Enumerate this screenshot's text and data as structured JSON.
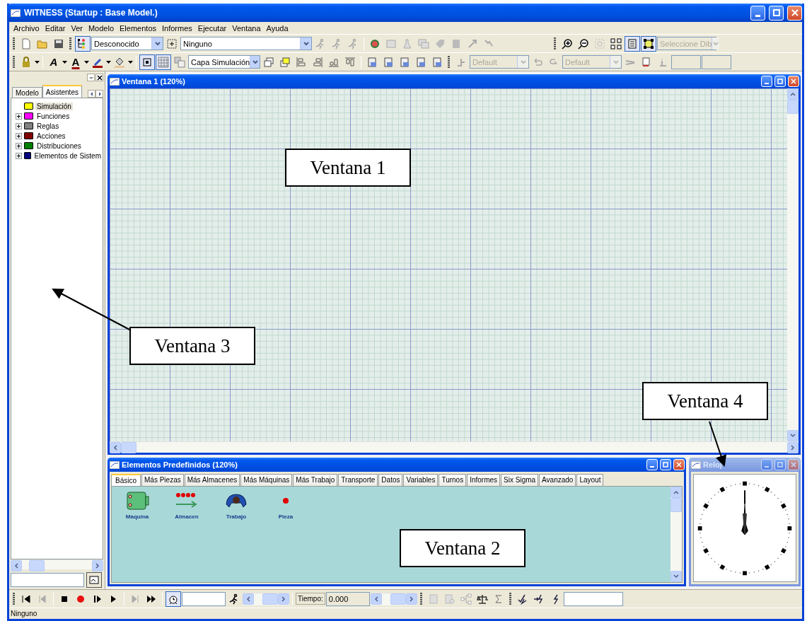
{
  "window": {
    "title": "WITNESS (Startup : Base Model.)"
  },
  "menu": [
    "Archivo",
    "Editar",
    "Ver",
    "Modelo",
    "Elementos",
    "Informes",
    "Ejecutar",
    "Ventana",
    "Ayuda"
  ],
  "combos": [
    {
      "value": "Desconocido",
      "disabled": false
    },
    {
      "value": "Ninguno",
      "disabled": false
    },
    {
      "value": "Seleccione Dib",
      "disabled": true
    },
    {
      "value": "Capa Simulación",
      "disabled": false
    },
    {
      "value": "Default",
      "disabled": true
    },
    {
      "value": "Default",
      "disabled": true
    }
  ],
  "toggles": [
    {
      "selected": true
    },
    {
      "selected": true
    },
    {
      "selected": true
    },
    {
      "selected": true
    },
    {
      "selected": true
    }
  ],
  "font_buttons": [
    "A",
    "A"
  ],
  "left_panel": {
    "tabs": [
      {
        "label": "Modelo",
        "selected": false
      },
      {
        "label": "Asistentes",
        "selected": true
      }
    ],
    "tree": [
      {
        "label": "Simulación",
        "color": "#ffff00",
        "expandable": false,
        "selected": true
      },
      {
        "label": "Funciones",
        "color": "#ff00ff",
        "expandable": true,
        "selected": false
      },
      {
        "label": "Reglas",
        "color": "#808080",
        "expandable": true,
        "selected": false
      },
      {
        "label": "Acciones",
        "color": "#800000",
        "expandable": true,
        "selected": false
      },
      {
        "label": "Distribuciones",
        "color": "#008000",
        "expandable": true,
        "selected": false
      },
      {
        "label": "Elementos de Sistem",
        "color": "#000080",
        "expandable": true,
        "selected": false
      }
    ]
  },
  "canvas_window": {
    "title": "Ventana 1 (120%)",
    "active": true
  },
  "elements_window": {
    "title": "Elementos Predefinidos (120%)",
    "active": true,
    "tabs": [
      {
        "label": "Básico",
        "selected": true
      },
      {
        "label": "Más Piezas",
        "selected": false
      },
      {
        "label": "Más Almacenes",
        "selected": false
      },
      {
        "label": "Más Máquinas",
        "selected": false
      },
      {
        "label": "Más Trabajo",
        "selected": false
      },
      {
        "label": "Transporte",
        "selected": false
      },
      {
        "label": "Datos",
        "selected": false
      },
      {
        "label": "Variables",
        "selected": false
      },
      {
        "label": "Turnos",
        "selected": false
      },
      {
        "label": "Informes",
        "selected": false
      },
      {
        "label": "Six Sigma",
        "selected": false
      },
      {
        "label": "Avanzado",
        "selected": false
      },
      {
        "label": "Layout",
        "selected": false
      }
    ],
    "items": [
      {
        "label": "Maquina",
        "kind": "machine"
      },
      {
        "label": "Almacen",
        "kind": "buffer"
      },
      {
        "label": "Trabajo",
        "kind": "labor"
      },
      {
        "label": "Pieza",
        "kind": "part"
      }
    ]
  },
  "clock_window": {
    "title": "Reloj",
    "active": false
  },
  "run_bar": {
    "time_label": "Tiempo:",
    "time_value": "0.000"
  },
  "status_bar": "Ninguno",
  "annotations": [
    {
      "text": "Ventana 1",
      "arrow": false
    },
    {
      "text": "Ventana 3",
      "arrow": true
    },
    {
      "text": "Ventana 2",
      "arrow": false
    },
    {
      "text": "Ventana 4",
      "arrow": true
    }
  ]
}
